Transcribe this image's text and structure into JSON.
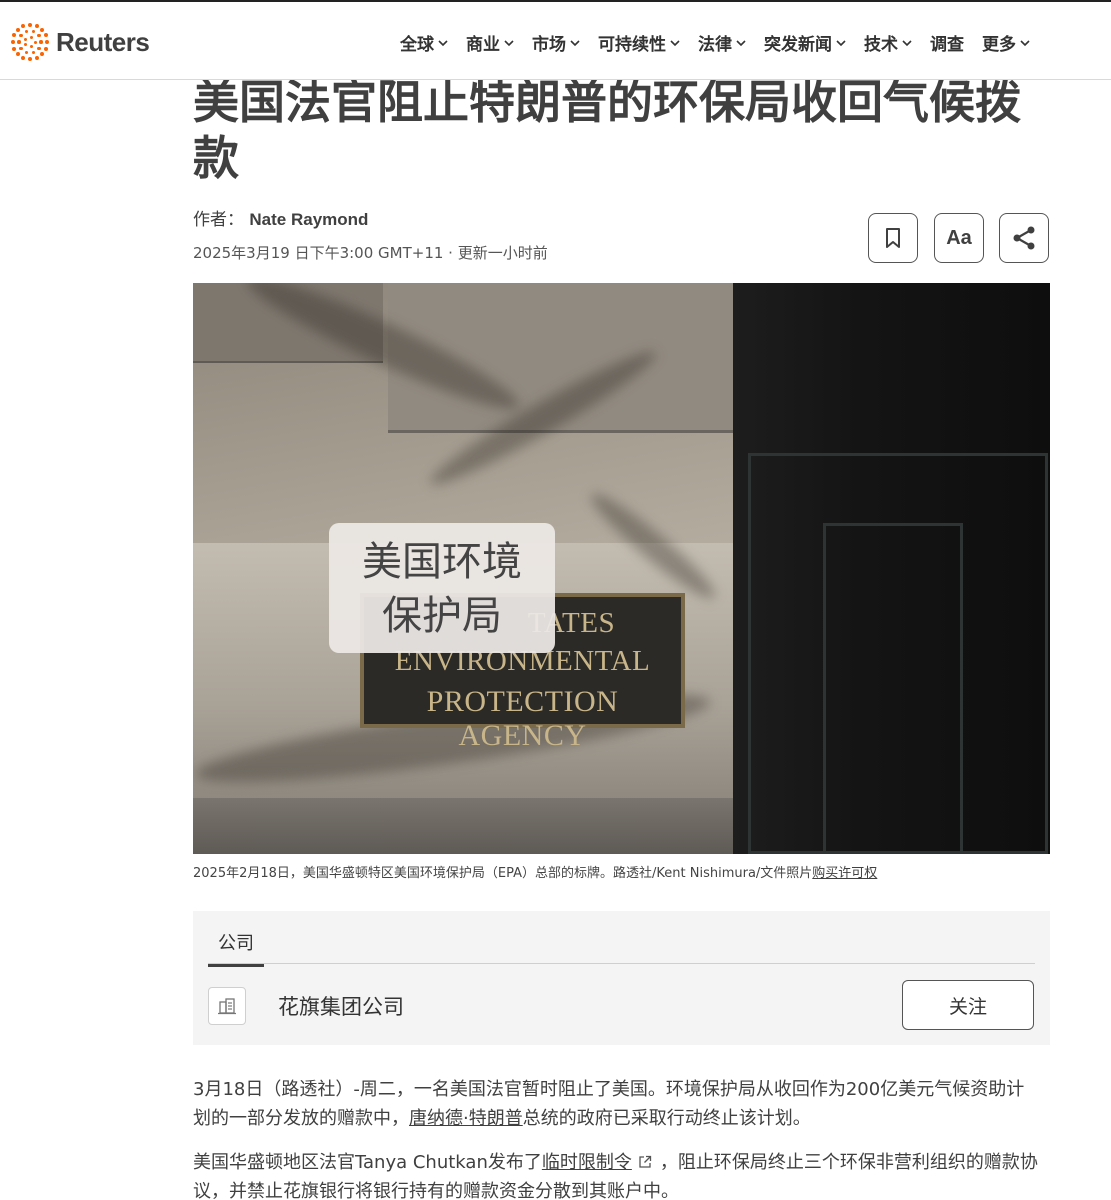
{
  "header": {
    "brand": "Reuters",
    "nav": [
      {
        "label": "全球",
        "has_dropdown": true
      },
      {
        "label": "商业",
        "has_dropdown": true
      },
      {
        "label": "市场",
        "has_dropdown": true
      },
      {
        "label": "可持续性",
        "has_dropdown": true
      },
      {
        "label": "法律",
        "has_dropdown": true
      },
      {
        "label": "突发新闻",
        "has_dropdown": true
      },
      {
        "label": "技术",
        "has_dropdown": true
      },
      {
        "label": "调查",
        "has_dropdown": false
      },
      {
        "label": "更多",
        "has_dropdown": true
      }
    ],
    "brand_color": "#fa6400"
  },
  "article": {
    "headline": "美国法官阻止特朗普的环保局收回气候拨款",
    "byline_prefix": "作者：",
    "author": "Nate Raymond",
    "dateline": "2025年3月19 日下午3:00 GMT+11 · 更新一小时前",
    "tools": {
      "bookmark_icon": "bookmark-icon",
      "text_size_label": "Aa",
      "share_icon": "share-icon"
    }
  },
  "photo": {
    "overlay_label": [
      "美国环境",
      "保护局"
    ],
    "plaque_lines": [
      "TATES",
      "ENVIRONMENTAL",
      "PROTECTION AGENCY"
    ],
    "caption": "2025年2月18日，美国华盛顿特区美国环境保护局（EPA）总部的标牌。路透社/Kent Nishimura/文件照片",
    "caption_link": "购买许可权"
  },
  "companies": {
    "tab_label": "公司",
    "items": [
      {
        "name": "花旗集团公司",
        "follow_label": "关注",
        "icon": "building-icon"
      }
    ]
  },
  "body": {
    "p1": {
      "before": "3月18日（路透社）-周二，一名美国法官暂时阻止了美国。环境保护局从收回作为200亿美元气候资助计划的一部分发放的赠款中，",
      "link": "唐纳德·特朗普",
      "after": "总统的政府已采取行动终止该计划。"
    },
    "p2": {
      "before": "美国华盛顿地区法官Tanya Chutkan发布了",
      "link": "临时限制令",
      "after": "，阻止环保局终止三个环保非营利组织的赠款协议，并禁止花旗银行将银行持有的赠款资金分散到其账户中。"
    }
  }
}
